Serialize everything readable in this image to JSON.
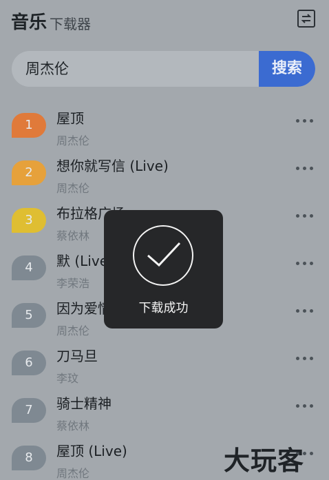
{
  "header": {
    "brand_main": "音乐",
    "brand_sub": "下载器",
    "switch_icon": "switch-icon"
  },
  "search": {
    "value": "周杰伦",
    "button": "搜索"
  },
  "songs": [
    {
      "rank": "1",
      "title": "屋顶",
      "artist": "周杰伦"
    },
    {
      "rank": "2",
      "title": "想你就写信 (Live)",
      "artist": "周杰伦"
    },
    {
      "rank": "3",
      "title": "布拉格广场",
      "artist": "蔡依林"
    },
    {
      "rank": "4",
      "title": "默 (Live",
      "artist": "李荣浩"
    },
    {
      "rank": "5",
      "title": "因为爱情",
      "artist": "周杰伦"
    },
    {
      "rank": "6",
      "title": "刀马旦",
      "artist": "李玟"
    },
    {
      "rank": "7",
      "title": "骑士精神",
      "artist": "蔡依林"
    },
    {
      "rank": "8",
      "title": "屋顶 (Live)",
      "artist": "周杰伦"
    }
  ],
  "toast": {
    "text": "下载成功",
    "icon": "check-circle-icon"
  },
  "watermark": {
    "text": "大玩客"
  }
}
